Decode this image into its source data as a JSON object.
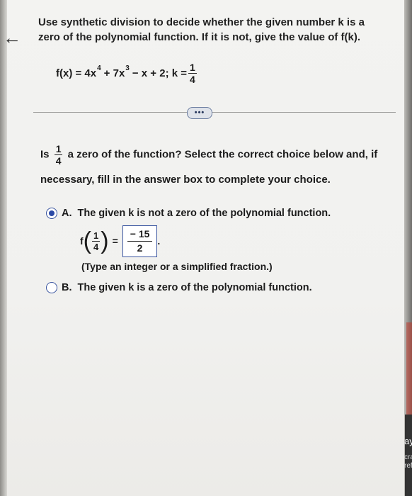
{
  "nav": {
    "back_icon": "←"
  },
  "question": {
    "prompt": "Use synthetic division to decide whether the given number k is a zero of the polynomial function. If it is not, give the value of f(k).",
    "eq_lhs": "f(x) = 4x",
    "exp1": "4",
    "eq_mid": "+ 7x",
    "exp2": "3",
    "eq_tail": "− x + 2; k =",
    "k_num": "1",
    "k_den": "4"
  },
  "more_button": "•••",
  "part": {
    "is_word": "Is",
    "frac_num": "1",
    "frac_den": "4",
    "text": "a zero of the function? Select the correct choice below and, if",
    "line2": "necessary, fill in the answer box to complete your choice."
  },
  "choices": [
    {
      "letter": "A.",
      "text": "The given k is not a zero of the polynomial function.",
      "selected": true
    },
    {
      "letter": "B.",
      "text": "The given k is a zero of the polynomial function.",
      "selected": false
    }
  ],
  "answer": {
    "f": "f",
    "arg_num": "1",
    "arg_den": "4",
    "equals": "=",
    "value_num": "− 15",
    "value_den": "2",
    "period": "."
  },
  "hint": "(Type an integer or a simplified fraction.)",
  "edge_text": {
    "a": "ay",
    "b": "craf",
    "c": "refs"
  }
}
